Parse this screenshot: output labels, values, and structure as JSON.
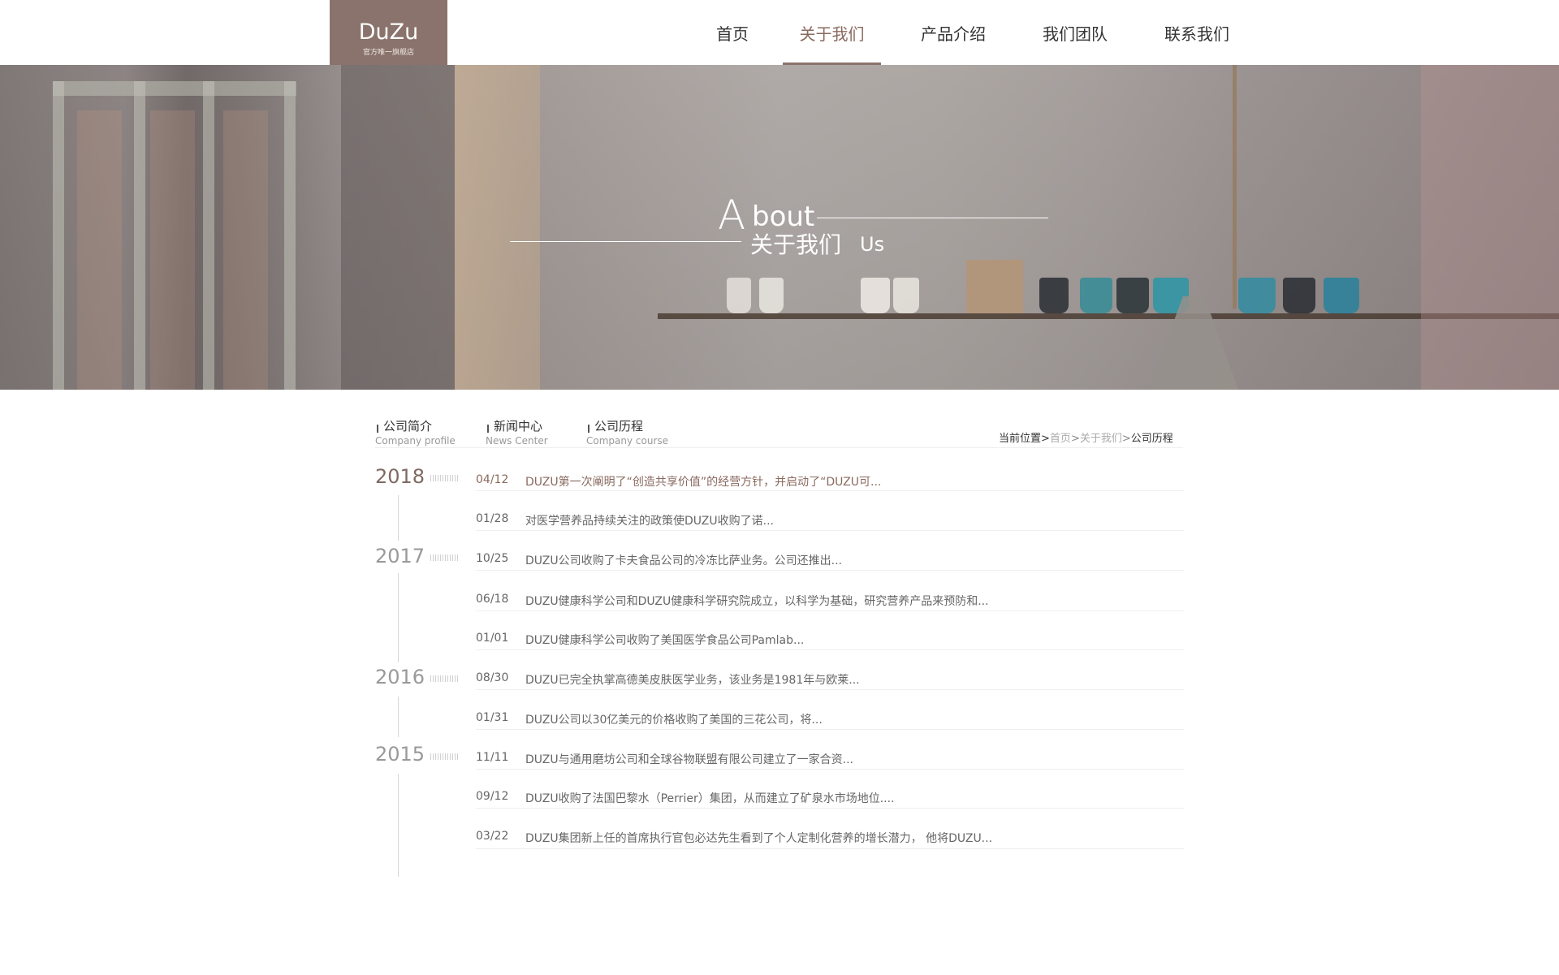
{
  "header": {
    "logo_text": "DuZu",
    "logo_sub": "官方唯一旗舰店",
    "nav": [
      {
        "label": "首页"
      },
      {
        "label": "关于我们"
      },
      {
        "label": "产品介绍"
      },
      {
        "label": "我们团队"
      },
      {
        "label": "联系我们"
      }
    ],
    "active_nav": "关于我们"
  },
  "banner": {
    "big_letter": "A",
    "word": "bout",
    "cn_title": "关于我们",
    "us": "Us"
  },
  "subnav": {
    "tabs": [
      {
        "cn": "公司简介",
        "en": "Company profile"
      },
      {
        "cn": "新闻中心",
        "en": "News Center"
      },
      {
        "cn": "公司历程",
        "en": "Company course"
      }
    ]
  },
  "breadcrumb": {
    "prefix": "当前位置",
    "items": [
      "首页",
      "关于我们",
      "公司历程"
    ],
    "separator": ">"
  },
  "timeline": [
    {
      "year": "2018",
      "entries": [
        {
          "date": "04/12",
          "title": "DUZU第一次阐明了“创造共享价值”的经营方针，并启动了“DUZU可..."
        },
        {
          "date": "01/28",
          "title": "对医学营养品持续关注的政策使DUZU收购了诺..."
        }
      ]
    },
    {
      "year": "2017",
      "entries": [
        {
          "date": "10/25",
          "title": "DUZU公司收购了卡夫食品公司的冷冻比萨业务。公司还推出..."
        },
        {
          "date": "06/18",
          "title": "DUZU健康科学公司和DUZU健康科学研究院成立，以科学为基础，研究营养产品来预防和..."
        },
        {
          "date": "01/01",
          "title": "DUZU健康科学公司收购了美国医学食品公司Pamlab..."
        }
      ]
    },
    {
      "year": "2016",
      "entries": [
        {
          "date": "08/30",
          "title": "DUZU已完全执掌高德美皮肤医学业务，该业务是1981年与欧莱..."
        },
        {
          "date": "01/31",
          "title": "DUZU公司以30亿美元的价格收购了美国的三花公司，将..."
        }
      ]
    },
    {
      "year": "2015",
      "entries": [
        {
          "date": "11/11",
          "title": "DUZU与通用磨坊公司和全球谷物联盟有限公司建立了一家合资..."
        },
        {
          "date": "09/12",
          "title": "DUZU收购了法国巴黎水（Perrier）集团，从而建立了矿泉水市场地位...."
        },
        {
          "date": "03/22",
          "title": "DUZU集团新上任的首席执行官包必达先生看到了个人定制化营养的增长潜力， 他将DUZU..."
        }
      ]
    }
  ],
  "colors": {
    "brand": "#8a736c",
    "accent_text": "#8a6a5f"
  }
}
